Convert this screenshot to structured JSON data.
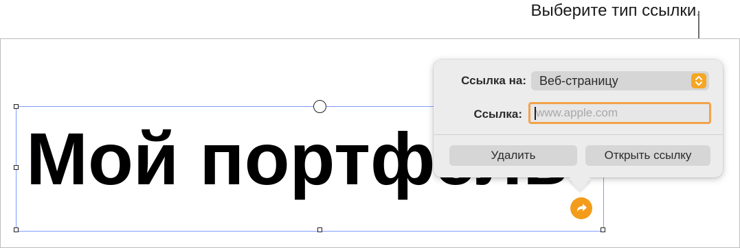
{
  "callout": {
    "text": "Выберите тип ссылки."
  },
  "canvas": {
    "title_text": "Мой портфель"
  },
  "link_popover": {
    "link_to_label": "Ссылка на:",
    "link_to_value": "Веб-страницу",
    "link_label": "Ссылка:",
    "link_placeholder": "www.apple.com",
    "remove_button": "Удалить",
    "open_link_button": "Открыть ссылку"
  },
  "icons": {
    "link_badge": "arrow-right-icon",
    "select_stepper": "chevron-up-down-icon"
  },
  "colors": {
    "accent": "#f5a623",
    "selection": "#7f9cff",
    "popover_bg": "#ececec"
  }
}
